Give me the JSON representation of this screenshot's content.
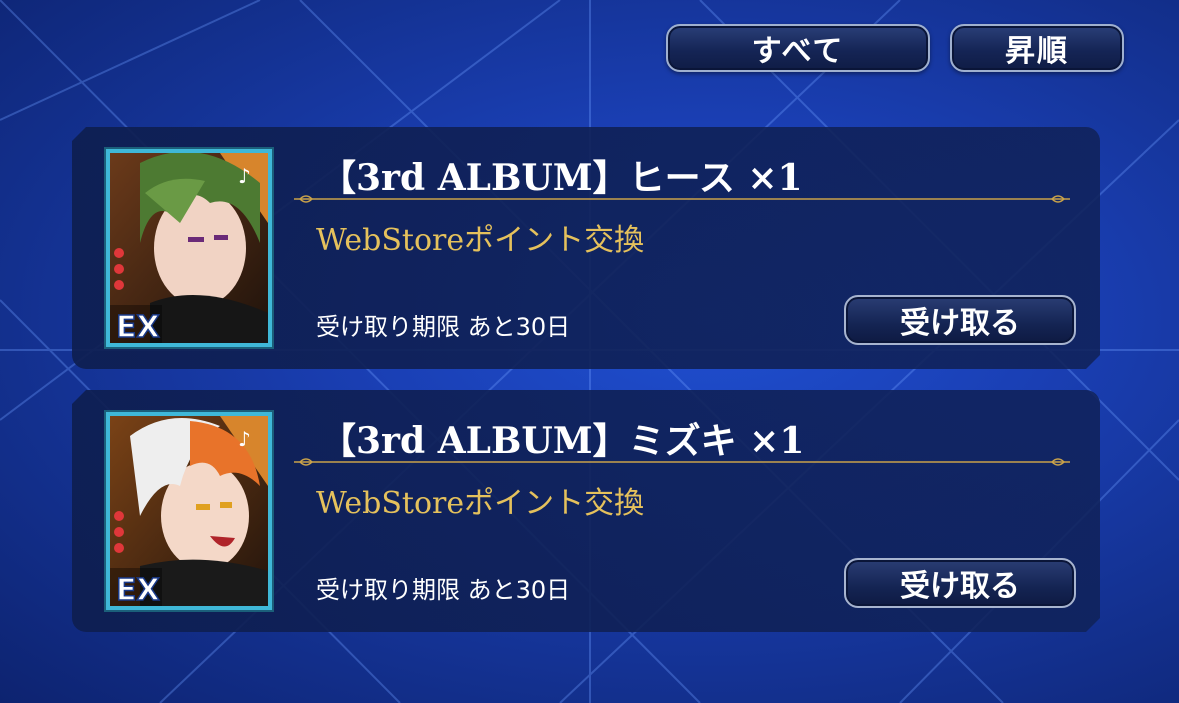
{
  "header": {
    "filter_label": "すべて",
    "sort_label": "昇順"
  },
  "items": [
    {
      "title": "【3rd ALBUM】ヒース ×1",
      "description": "WebStoreポイント交換",
      "deadline": "受け取り期限 あと30日",
      "receive_label": "受け取る",
      "rarity_badge": "EX",
      "portrait": "green-haired character card"
    },
    {
      "title": "【3rd ALBUM】ミズキ ×1",
      "description": "WebStoreポイント交換",
      "deadline": "受け取り期限 あと30日",
      "receive_label": "受け取る",
      "rarity_badge": "EX",
      "portrait": "white-orange-haired character card"
    }
  ],
  "colors": {
    "accent_gold": "#e5c15c",
    "frame_cyan": "#3fb8d8",
    "background": "#1a3fb4"
  }
}
